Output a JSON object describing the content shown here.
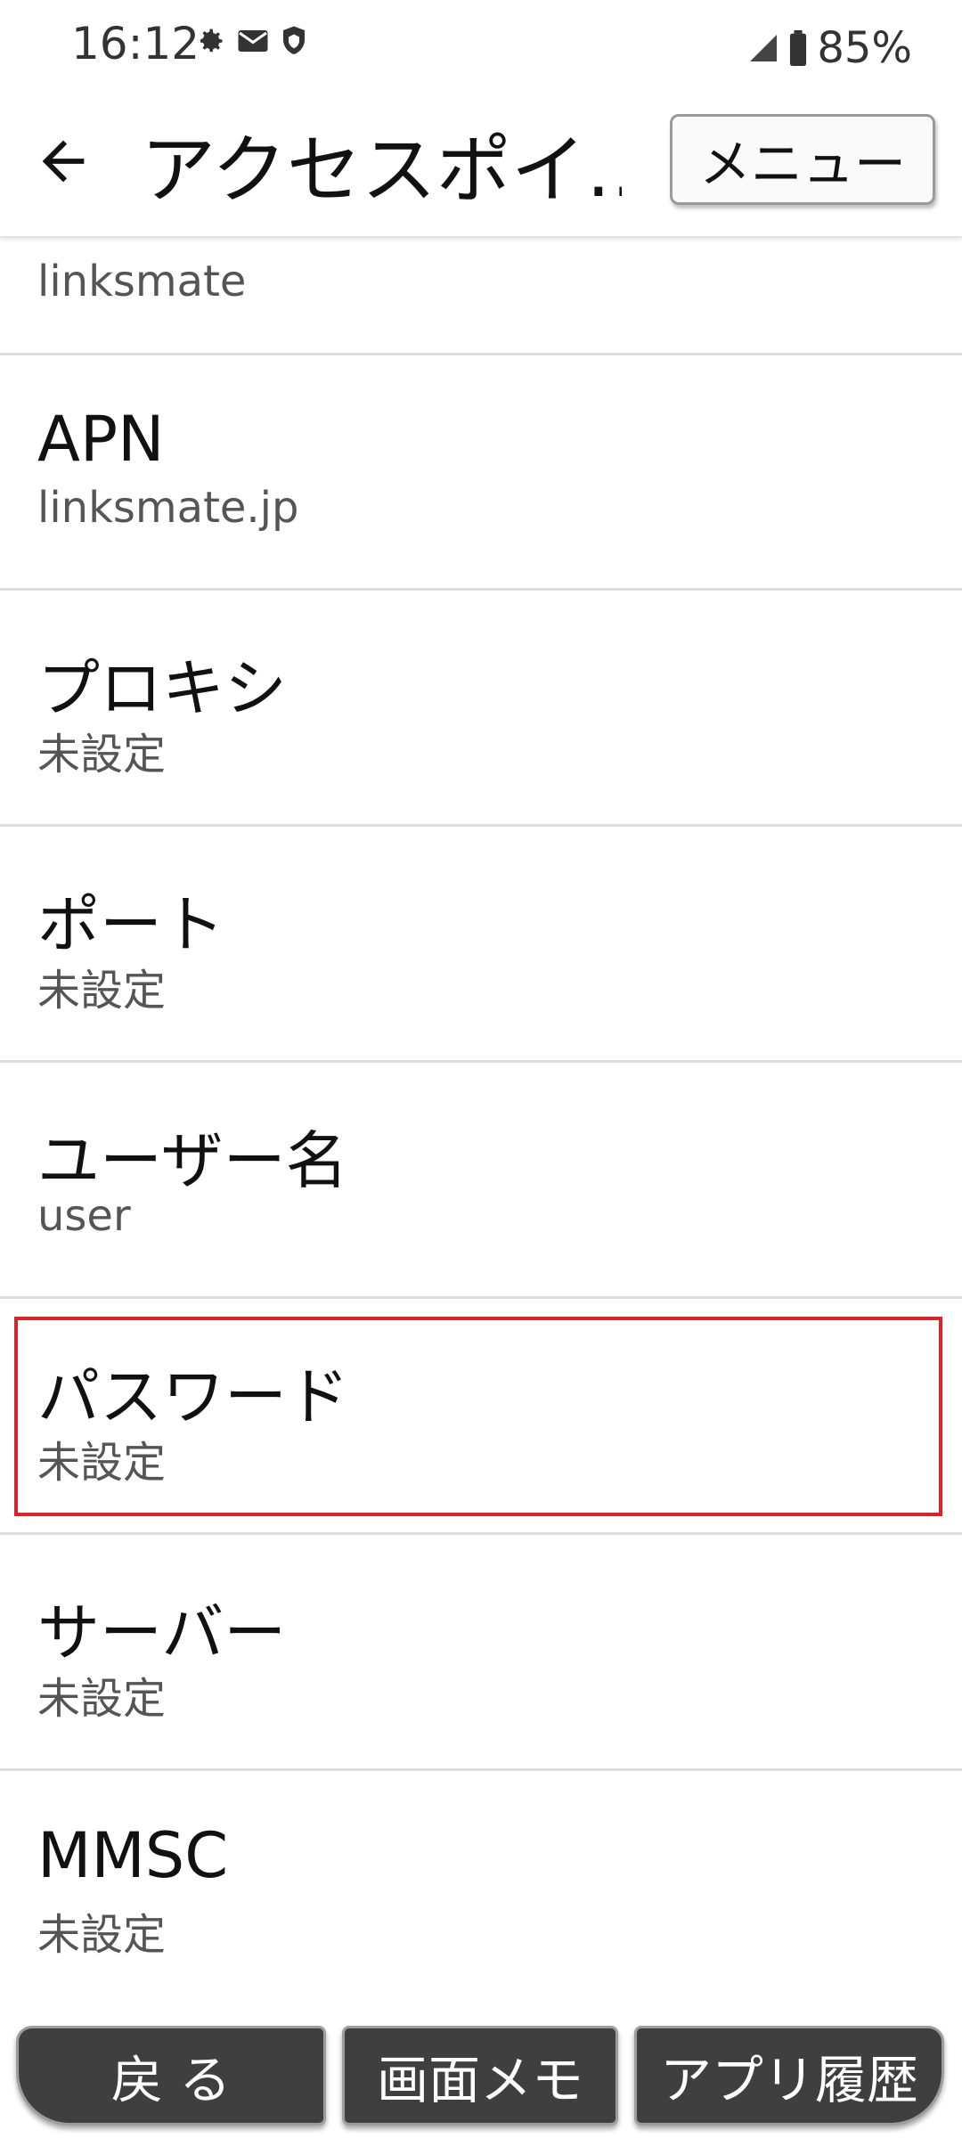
{
  "status_bar": {
    "time": "16:12",
    "battery": "85%",
    "icons": [
      "gear-icon",
      "mail-icon",
      "shield-icon",
      "signal-icon",
      "battery-icon"
    ]
  },
  "app_bar": {
    "title": "アクセスポイ…",
    "menu_label": "メニュー"
  },
  "list": {
    "partial_summary": "linksmate",
    "items": [
      {
        "title": "APN",
        "summary": "linksmate.jp"
      },
      {
        "title": "プロキシ",
        "summary": "未設定"
      },
      {
        "title": "ポート",
        "summary": "未設定"
      },
      {
        "title": "ユーザー名",
        "summary": "user"
      },
      {
        "title": "パスワード",
        "summary": "未設定"
      },
      {
        "title": "サーバー",
        "summary": "未設定"
      },
      {
        "title": "MMSC",
        "summary": "未設定"
      }
    ]
  },
  "bottom_bar": {
    "back_label": "戻 る",
    "memo_label": "画面メモ",
    "history_label": "アプリ履歴"
  },
  "colors": {
    "highlight": "#d9232d",
    "nav_button_bg": "#3f3f3f"
  }
}
